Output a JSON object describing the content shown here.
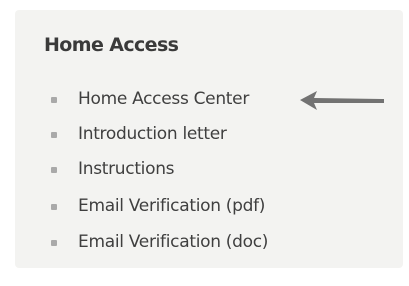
{
  "panel": {
    "title": "Home Access",
    "links": [
      {
        "label": "Home Access Center"
      },
      {
        "label": "Introduction letter"
      },
      {
        "label": "Instructions"
      },
      {
        "label": "Email Verification (pdf)"
      },
      {
        "label": "Email Verification (doc)"
      }
    ],
    "colors": {
      "panel_background": "#f3f3f1",
      "text": "#3f3f3f",
      "bullet": "#a9a9a9",
      "arrow": "#727272"
    },
    "icons": {
      "bullet": "square-bullet-icon",
      "pointer": "left-arrow-icon"
    }
  }
}
